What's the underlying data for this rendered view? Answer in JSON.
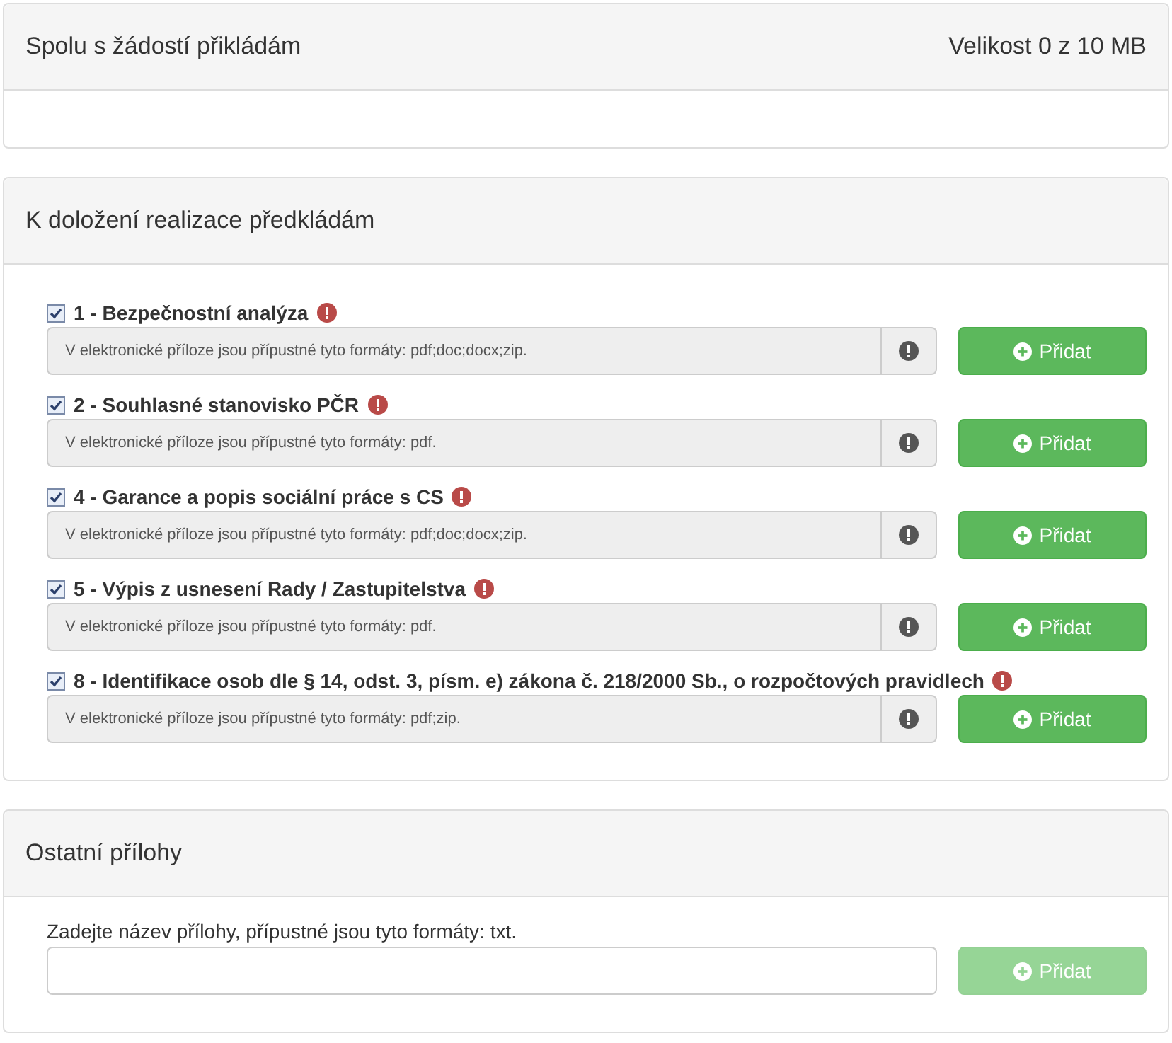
{
  "panels": [
    {
      "kind": "summary",
      "title": "Spolu s žádostí přikládám",
      "size": "Velikost 0 z 10 MB"
    },
    {
      "kind": "documents",
      "title": "K doložení realizace předkládám",
      "items": [
        {
          "label": "1 - Bezpečnostní analýza",
          "checked": true,
          "formats": "V elektronické příloze jsou přípustné tyto formáty: pdf;doc;docx;zip.",
          "button": "Přidat"
        },
        {
          "label": "2 - Souhlasné stanovisko PČR",
          "checked": true,
          "formats": "V elektronické příloze jsou přípustné tyto formáty: pdf.",
          "button": "Přidat"
        },
        {
          "label": "4 - Garance a popis sociální práce s CS",
          "checked": true,
          "formats": "V elektronické příloze jsou přípustné tyto formáty: pdf;doc;docx;zip.",
          "button": "Přidat"
        },
        {
          "label": "5 - Výpis z usnesení Rady / Zastupitelstva",
          "checked": true,
          "formats": "V elektronické příloze jsou přípustné tyto formáty: pdf.",
          "button": "Přidat"
        },
        {
          "label": "8 - Identifikace osob dle § 14, odst. 3, písm. e) zákona č. 218/2000 Sb., o rozpočtových pravidlech",
          "checked": true,
          "formats": "V elektronické příloze jsou přípustné tyto formáty: pdf;zip.",
          "button": "Přidat"
        }
      ]
    },
    {
      "kind": "other",
      "title": "Ostatní přílohy",
      "prompt": "Zadejte název přílohy, přípustné jsou tyto formáty: txt.",
      "button": "Přidat",
      "disabled": true
    }
  ]
}
